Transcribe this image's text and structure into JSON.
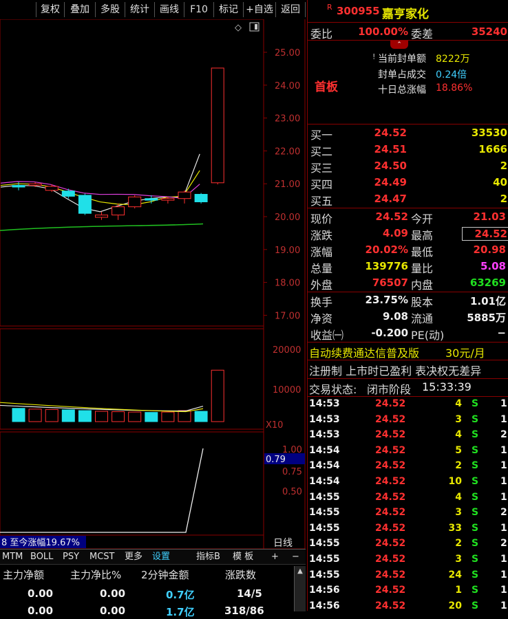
{
  "toolbar": {
    "buttons": [
      "复权",
      "叠加",
      "多股",
      "统计",
      "画线",
      "F10",
      "标记",
      "+自选",
      "返回"
    ]
  },
  "stock": {
    "badge": "R",
    "code": "300955",
    "name": "嘉亨家化",
    "limit_label": "首板"
  },
  "chart": {
    "price_ticks": [
      "25.00",
      "24.00",
      "23.00",
      "22.00",
      "21.00",
      "20.00",
      "19.00",
      "18.00",
      "17.00"
    ],
    "vol_ticks": [
      "20000",
      "10000"
    ],
    "vol_unit": "X10",
    "ind_ticks": [
      "1.00",
      "0.75",
      "0.50"
    ],
    "ind_value": "0.79",
    "footer_text": "8 至今涨幅19.67%",
    "period_label": "日线",
    "candles": [
      {
        "o": 20.95,
        "c": 20.9,
        "h": 21.05,
        "l": 20.8
      },
      {
        "o": 20.95,
        "c": 21.0,
        "h": 21.05,
        "l": 20.9
      },
      {
        "o": 20.8,
        "c": 20.92,
        "h": 20.98,
        "l": 20.75
      },
      {
        "o": 20.78,
        "c": 20.62,
        "h": 20.85,
        "l": 20.55
      },
      {
        "o": 20.65,
        "c": 20.1,
        "h": 20.7,
        "l": 20.05
      },
      {
        "o": 19.98,
        "c": 20.05,
        "h": 20.15,
        "l": 19.9
      },
      {
        "o": 20.05,
        "c": 20.3,
        "h": 20.4,
        "l": 19.9
      },
      {
        "o": 20.3,
        "c": 20.6,
        "h": 20.65,
        "l": 20.25
      },
      {
        "o": 20.55,
        "c": 20.5,
        "h": 20.65,
        "l": 20.4
      },
      {
        "o": 20.5,
        "c": 20.55,
        "h": 20.6,
        "l": 20.4
      },
      {
        "o": 20.55,
        "c": 20.75,
        "h": 20.8,
        "l": 20.4
      },
      {
        "o": 20.68,
        "c": 20.45,
        "h": 20.72,
        "l": 20.4
      },
      {
        "o": 21.03,
        "c": 24.52,
        "h": 24.52,
        "l": 20.98
      }
    ],
    "volumes": [
      3600,
      3400,
      3300,
      3200,
      3000,
      2800,
      2700,
      2600,
      2500,
      2600,
      3000,
      2800,
      13977
    ]
  },
  "quote": {
    "weibi_label": "委比",
    "weibi": "100.00%",
    "weicha_label": "委差",
    "weicha": "35240",
    "seal_amount_label": "当前封单额",
    "seal_amount": "8222万",
    "seal_ratio_label": "封单占成交",
    "seal_ratio": "0.24倍",
    "ten_day_label": "十日总涨幅",
    "ten_day": "18.86%",
    "bids": [
      {
        "label": "买一",
        "price": "24.52",
        "vol": "33530"
      },
      {
        "label": "买二",
        "price": "24.51",
        "vol": "1666"
      },
      {
        "label": "买三",
        "price": "24.50",
        "vol": "2"
      },
      {
        "label": "买四",
        "price": "24.49",
        "vol": "40"
      },
      {
        "label": "买五",
        "price": "24.47",
        "vol": "2"
      }
    ],
    "stats": [
      {
        "l1": "现价",
        "v1": "24.52",
        "c1": "red",
        "l2": "今开",
        "v2": "21.03",
        "c2": "red"
      },
      {
        "l1": "涨跌",
        "v1": "4.09",
        "c1": "red",
        "l2": "最高",
        "v2": "24.52",
        "c2": "red"
      },
      {
        "l1": "涨幅",
        "v1": "20.02%",
        "c1": "red",
        "l2": "最低",
        "v2": "20.98",
        "c2": "red"
      },
      {
        "l1": "总量",
        "v1": "139776",
        "c1": "yel",
        "l2": "量比",
        "v2": "5.08",
        "c2": "mag"
      },
      {
        "l1": "外盘",
        "v1": "76507",
        "c1": "red",
        "l2": "内盘",
        "v2": "63269",
        "c2": "grn"
      }
    ],
    "stats2": [
      {
        "l1": "换手",
        "v1": "23.75%",
        "l2": "股本",
        "v2": "1.01亿"
      },
      {
        "l1": "净资",
        "v1": "9.08",
        "l2": "流通",
        "v2": "5885万"
      },
      {
        "l1": "收益㈠",
        "v1": "-0.200",
        "l2": "PE(动)",
        "v2": "−"
      }
    ],
    "promo1": "自动续费通达信普及版",
    "promo1_price": "30元/月",
    "promo2": "注册制 上市时已盈利 表决权无差异",
    "status_label": "交易状态:",
    "status_value": "闭市阶段",
    "status_time": "15:33:39"
  },
  "ticks": [
    {
      "t": "14:53",
      "p": "24.52",
      "v": "4",
      "s": "S",
      "n": "1"
    },
    {
      "t": "14:53",
      "p": "24.52",
      "v": "3",
      "s": "S",
      "n": "1"
    },
    {
      "t": "14:53",
      "p": "24.52",
      "v": "4",
      "s": "S",
      "n": "2"
    },
    {
      "t": "14:54",
      "p": "24.52",
      "v": "5",
      "s": "S",
      "n": "1"
    },
    {
      "t": "14:54",
      "p": "24.52",
      "v": "2",
      "s": "S",
      "n": "1"
    },
    {
      "t": "14:54",
      "p": "24.52",
      "v": "10",
      "s": "S",
      "n": "1"
    },
    {
      "t": "14:55",
      "p": "24.52",
      "v": "4",
      "s": "S",
      "n": "1"
    },
    {
      "t": "14:55",
      "p": "24.52",
      "v": "3",
      "s": "S",
      "n": "2"
    },
    {
      "t": "14:55",
      "p": "24.52",
      "v": "33",
      "s": "S",
      "n": "1"
    },
    {
      "t": "14:55",
      "p": "24.52",
      "v": "2",
      "s": "S",
      "n": "2"
    },
    {
      "t": "14:55",
      "p": "24.52",
      "v": "3",
      "s": "S",
      "n": "1"
    },
    {
      "t": "14:55",
      "p": "24.52",
      "v": "24",
      "s": "S",
      "n": "1"
    },
    {
      "t": "14:56",
      "p": "24.52",
      "v": "1",
      "s": "S",
      "n": "1"
    },
    {
      "t": "14:56",
      "p": "24.52",
      "v": "20",
      "s": "S",
      "n": "1"
    }
  ],
  "tabs": [
    "MTM",
    "BOLL",
    "PSY",
    "MCST",
    "更多",
    "设置",
    "指标B",
    "模 板",
    "+",
    "−"
  ],
  "table": {
    "headers": [
      "主力净额",
      "主力净比%",
      "2分钟金额",
      "涨跌数"
    ],
    "row1": [
      "0.00",
      "0.00",
      "0.7亿",
      "14/5"
    ],
    "row2": [
      "0.00",
      "0.00",
      "1.7亿",
      "318/86"
    ]
  },
  "colors": {
    "up": "#ff3030",
    "down": "#20e0e8",
    "ma1": "#e8e8e8",
    "ma2": "#e8e800",
    "ma3": "#e040e0",
    "ma4": "#20c020",
    "grid": "#8a0000"
  }
}
